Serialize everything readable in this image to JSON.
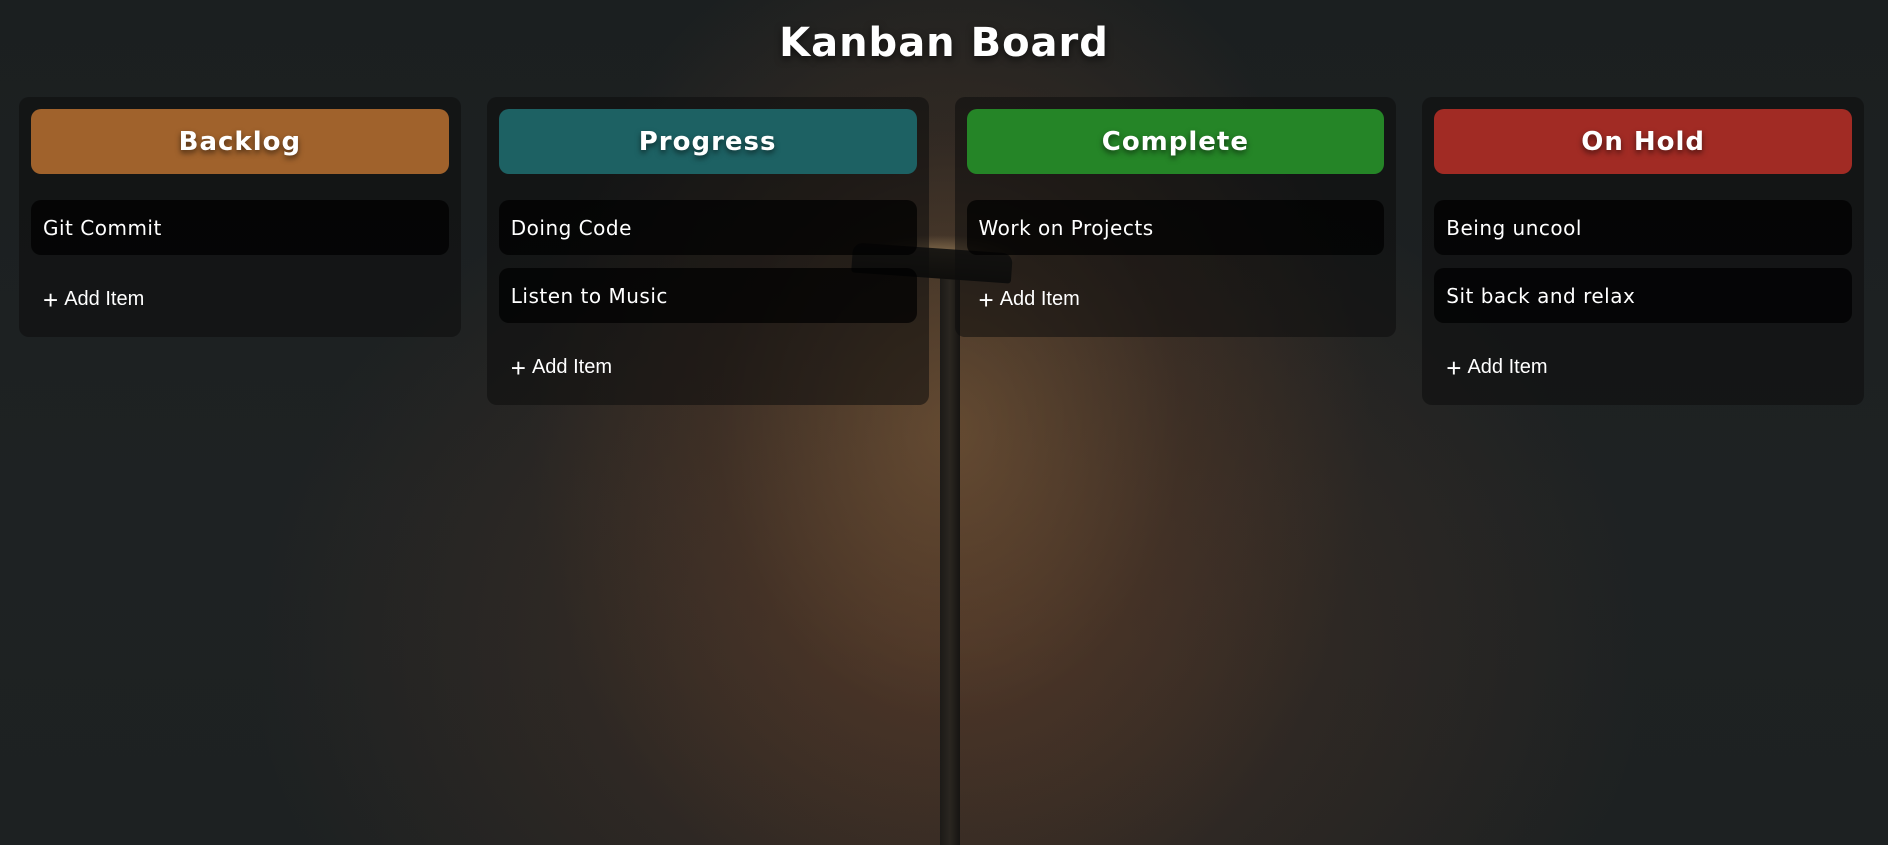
{
  "page": {
    "title": "Kanban Board"
  },
  "colors": {
    "backlog": "#a0622c",
    "progress": "#1d6163",
    "complete": "#258527",
    "on_hold": "#a12b24"
  },
  "columns": [
    {
      "title": "Backlog",
      "items": [
        "Git Commit"
      ],
      "add_label": "Add Item",
      "add_icon": "+"
    },
    {
      "title": "Progress",
      "items": [
        "Doing Code",
        "Listen to Music"
      ],
      "add_label": "Add Item",
      "add_icon": "+"
    },
    {
      "title": "Complete",
      "items": [
        "Work on Projects"
      ],
      "add_label": "Add Item",
      "add_icon": "+"
    },
    {
      "title": "On Hold",
      "items": [
        "Being uncool",
        "Sit back and relax"
      ],
      "add_label": "Add Item",
      "add_icon": "+"
    }
  ]
}
